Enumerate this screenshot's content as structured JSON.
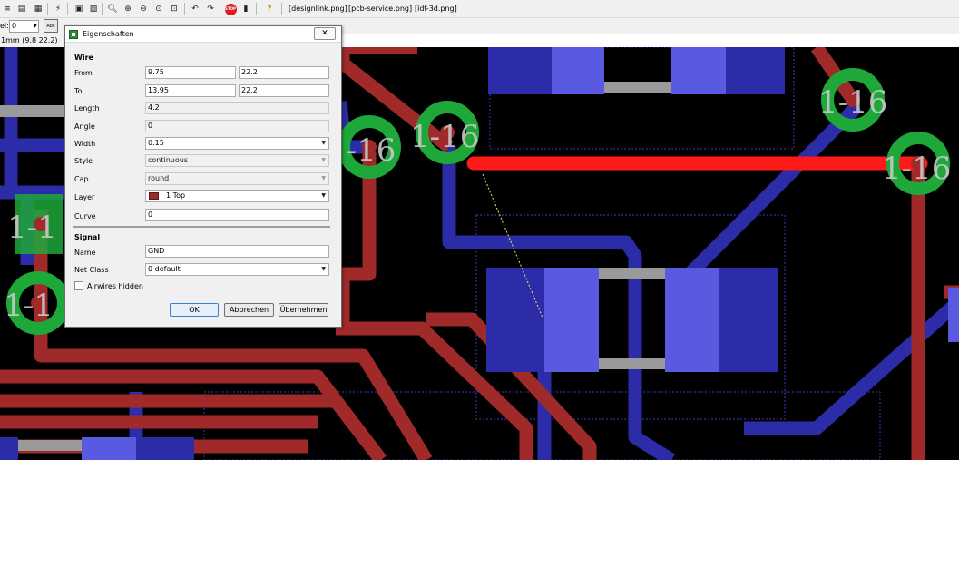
{
  "toolbar": {
    "links": [
      "[designlink.png]",
      "[pcb-service.png]",
      "[idf-3d.png]"
    ],
    "stop_label": "STOP",
    "help_label": "?"
  },
  "toolbar2": {
    "layer_label": "el:",
    "layer_value": "0",
    "abc_label": "Abc"
  },
  "coordinates": "1mm (9.8 22.2)",
  "dialog": {
    "title": "Eigenschaften",
    "close_label": "✕",
    "wire_section": "Wire",
    "from_label": "From",
    "from_x": "9.75",
    "from_y": "22.2",
    "to_label": "To",
    "to_x": "13.95",
    "to_y": "22.2",
    "length_label": "Length",
    "length_value": "4.2",
    "angle_label": "Angle",
    "angle_value": "0",
    "width_label": "Width",
    "width_value": "0.15",
    "style_label": "Style",
    "style_value": "continuous",
    "cap_label": "Cap",
    "cap_value": "round",
    "layer_label": "Layer",
    "layer_value": "1 Top",
    "curve_label": "Curve",
    "curve_value": "0",
    "signal_section": "Signal",
    "name_label": "Name",
    "name_value": "GND",
    "netclass_label": "Net Class",
    "netclass_value": "0 default",
    "airwires_label": "Airwires hidden",
    "ok_label": "OK",
    "cancel_label": "Abbrechen",
    "apply_label": "Übernehmen"
  },
  "canvas": {
    "pad_labels": [
      "1-16",
      "1-16",
      "1-16",
      "1-16",
      "1-1",
      "1-1"
    ],
    "colors": {
      "background": "#000000",
      "top_trace": "#a02a2a",
      "bottom_trace": "#2c2ca8",
      "selected_trace": "#ff1a1a",
      "pad_ring": "#1fa83a",
      "smd_pad": "#5a5ae0"
    }
  }
}
